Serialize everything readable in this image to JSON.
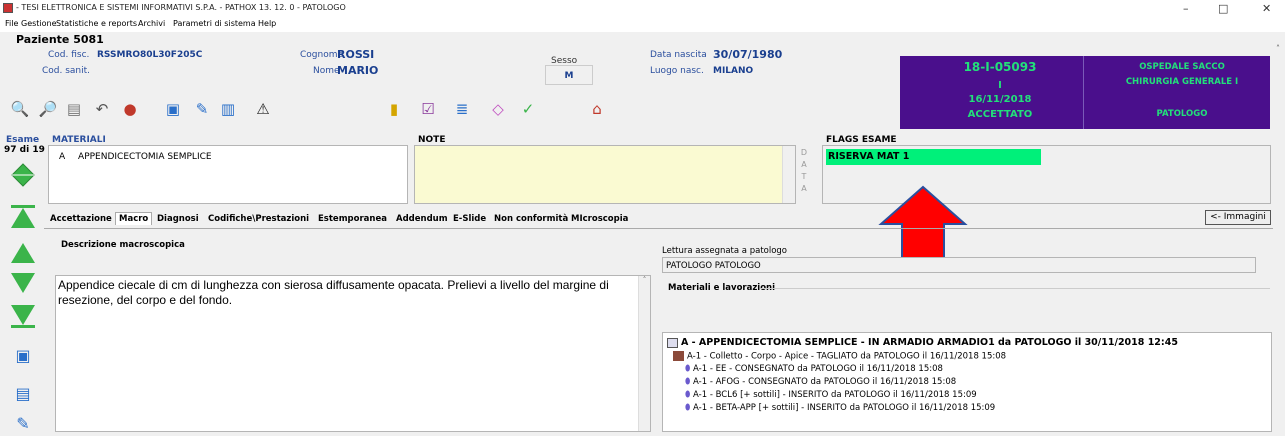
{
  "window": {
    "title": "- TESI ELETTRONICA E SISTEMI INFORMATIVI S.P.A. - PATHOX 13. 12. 0 - PATOLOGO",
    "minimize": "–",
    "maximize": "□",
    "close": "✕"
  },
  "menu": [
    "File",
    "Gestione",
    "Statistiche e reports",
    "Archivi",
    "Parametri di sistema",
    "Help"
  ],
  "patient": {
    "header": "Paziente 5081",
    "cod_fisc_label": "Cod. fisc.",
    "cod_fisc": "RSSMRO80L30F205C",
    "cod_sanit_label": "Cod. sanit.",
    "cognome_label": "Cognome",
    "cognome": "ROSSI",
    "nome_label": "Nome",
    "nome": "MARIO",
    "sesso_label": "Sesso",
    "sesso": "M",
    "data_nascita_label": "Data nascita",
    "data_nascita": "30/07/1980",
    "luogo_label": "Luogo nasc.",
    "luogo": "MILANO"
  },
  "exam_panel": {
    "code": "18-I-05093",
    "type": "I",
    "date": "16/11/2018",
    "status": "ACCETTATO",
    "hospital": "OSPEDALE SACCO",
    "department": "CHIRURGIA GENERALE I",
    "role": "PATOLOGO"
  },
  "exam": {
    "label": "Esame",
    "counter": "97 di 19"
  },
  "materiali": {
    "label": "MATERIALI",
    "items": [
      {
        "code": "A",
        "desc": "APPENDICECTOMIA SEMPLICE"
      }
    ]
  },
  "note": {
    "label": "NOTE",
    "data_letters": [
      "D",
      "A",
      "T",
      "A"
    ]
  },
  "flags": {
    "label": "FLAGS ESAME",
    "items": [
      "RISERVA MAT 1"
    ],
    "color": "#00f07a"
  },
  "tabs": [
    "Accettazione",
    "Macro",
    "Diagnosi",
    "Codifiche\\Prestazioni",
    "Estemporanea",
    "Addendum",
    "E-Slide",
    "Non conformità",
    "MIcroscopia"
  ],
  "immagini_button": "<- Immagini",
  "macro": {
    "label": "Descrizione macroscopica",
    "text": "Appendice ciecale di cm di lunghezza con sierosa diffusamente opacata. Prelievi a livello del margine di resezione, del corpo e del fondo."
  },
  "lettura": {
    "label": "Lettura assegnata a patologo",
    "value": "PATOLOGO PATOLOGO"
  },
  "lavorazioni": {
    "label": "Materiali e lavorazioni",
    "root": "A - APPENDICECTOMIA SEMPLICE - IN ARMADIO ARMADIO1 da PATOLOGO il 30/11/2018 12:45",
    "block": "A-1 - Colletto - Corpo - Apice - TAGLIATO da PATOLOGO il 16/11/2018 15:08",
    "slides": [
      "A-1 - EE - CONSEGNATO da PATOLOGO il 16/11/2018 15:08",
      "A-1 - AFOG - CONSEGNATO da PATOLOGO il 16/11/2018 15:08",
      "A-1 - BCL6 [+ sottili] - INSERITO da PATOLOGO il 16/11/2018 15:09",
      "A-1 - BETA-APP [+ sottili] - INSERITO da PATOLOGO il 16/11/2018 15:09"
    ]
  }
}
